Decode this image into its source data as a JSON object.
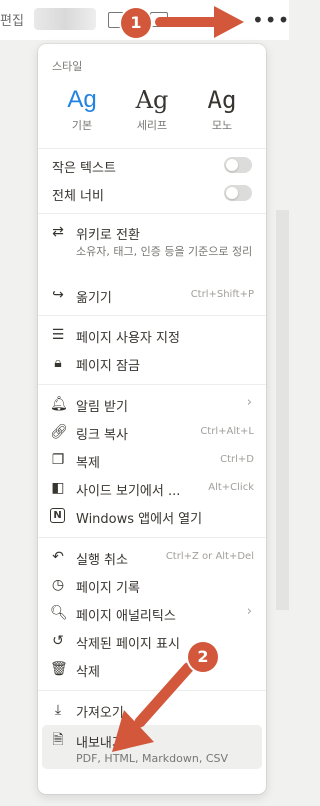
{
  "topbar": {
    "edit_label": "편집"
  },
  "menu": {
    "style_section_label": "스타일",
    "styles": [
      {
        "glyph": "Ag",
        "label": "기본",
        "selected": true
      },
      {
        "glyph": "Ag",
        "label": "세리프"
      },
      {
        "glyph": "Ag",
        "label": "모노"
      }
    ],
    "toggles": [
      {
        "label": "작은 텍스트",
        "on": false
      },
      {
        "label": "전체 너비",
        "on": false
      }
    ],
    "wiki": {
      "label": "위키로 전환",
      "description": "소유자, 태그, 인증 등을 기준으로 정리"
    },
    "move": {
      "label": "옮기기",
      "shortcut": "Ctrl+Shift+P"
    },
    "customize": {
      "label": "페이지 사용자 지정"
    },
    "lock": {
      "label": "페이지 잠금"
    },
    "notify": {
      "label": "알림 받기"
    },
    "copy_link": {
      "label": "링크 복사",
      "shortcut": "Ctrl+Alt+L"
    },
    "duplicate": {
      "label": "복제",
      "shortcut": "Ctrl+D"
    },
    "side_peek": {
      "label": "사이드 보기에서 ...",
      "shortcut": "Alt+Click"
    },
    "open_windows": {
      "label": "Windows 앱에서 열기"
    },
    "undo": {
      "label": "실행 취소",
      "shortcut": "Ctrl+Z or Alt+Del"
    },
    "history": {
      "label": "페이지 기록"
    },
    "analytics": {
      "label": "페이지 애널리틱스"
    },
    "deleted": {
      "label": "삭제된 페이지 표시"
    },
    "delete": {
      "label": "삭제"
    },
    "import": {
      "label": "가져오기"
    },
    "export": {
      "label": "내보내기",
      "description": "PDF, HTML, Markdown, CSV"
    }
  },
  "annotations": {
    "marker1": "1",
    "marker2": "2",
    "color": "#d2573b"
  },
  "colors": {
    "accent": "#2383e2"
  }
}
